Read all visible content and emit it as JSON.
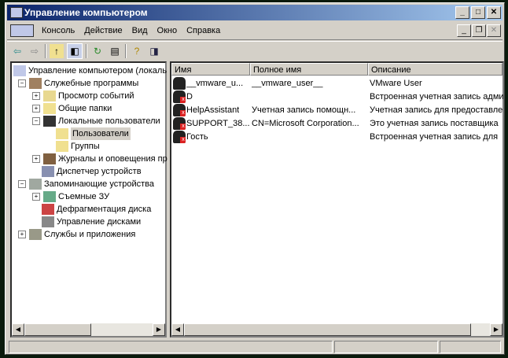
{
  "window": {
    "title": "Управление компьютером",
    "minimize": "_",
    "maximize": "□",
    "close": "✕"
  },
  "menu": [
    "Консоль",
    "Действие",
    "Вид",
    "Окно",
    "Справка"
  ],
  "toolbar": [
    "back-icon",
    "forward-icon",
    "up-folder-icon",
    "show-hide-tree-icon",
    "refresh-icon",
    "export-list-icon",
    "help-icon",
    "show-action-pane-icon"
  ],
  "tree": [
    {
      "label": "Управление компьютером (локаль",
      "level": 0,
      "exp": ""
    },
    {
      "label": "Служебные программы",
      "level": 1,
      "exp": "−"
    },
    {
      "label": "Просмотр событий",
      "level": 2,
      "exp": "+"
    },
    {
      "label": "Общие папки",
      "level": 2,
      "exp": "+"
    },
    {
      "label": "Локальные пользователи",
      "level": 2,
      "exp": "−"
    },
    {
      "label": "Пользователи",
      "level": 3,
      "exp": "",
      "selected": true
    },
    {
      "label": "Группы",
      "level": 3,
      "exp": ""
    },
    {
      "label": "Журналы и оповещения пр",
      "level": 2,
      "exp": "+"
    },
    {
      "label": "Диспетчер устройств",
      "level": 2,
      "exp": ""
    },
    {
      "label": "Запоминающие устройства",
      "level": 1,
      "exp": "−"
    },
    {
      "label": "Съемные ЗУ",
      "level": 2,
      "exp": "+"
    },
    {
      "label": "Дефрагментация диска",
      "level": 2,
      "exp": ""
    },
    {
      "label": "Управление дисками",
      "level": 2,
      "exp": ""
    },
    {
      "label": "Службы и приложения",
      "level": 1,
      "exp": "+"
    }
  ],
  "list": {
    "columns": [
      "Имя",
      "Полное имя",
      "Описание"
    ],
    "rows": [
      {
        "name": "__vmware_u...",
        "full": "__vmware_user__",
        "desc": "VMware User",
        "disabled": false
      },
      {
        "name": "D",
        "full": "",
        "desc": "Встроенная учетная запись адми",
        "disabled": true
      },
      {
        "name": "HelpAssistant",
        "full": "Учетная запись помощн...",
        "desc": "Учетная запись для предоставле",
        "disabled": true
      },
      {
        "name": "SUPPORT_38...",
        "full": "CN=Microsoft Corporation...",
        "desc": "Это учетная запись поставщика",
        "disabled": true
      },
      {
        "name": "Гость",
        "full": "",
        "desc": "Встроенная учетная запись для",
        "disabled": true
      }
    ]
  }
}
